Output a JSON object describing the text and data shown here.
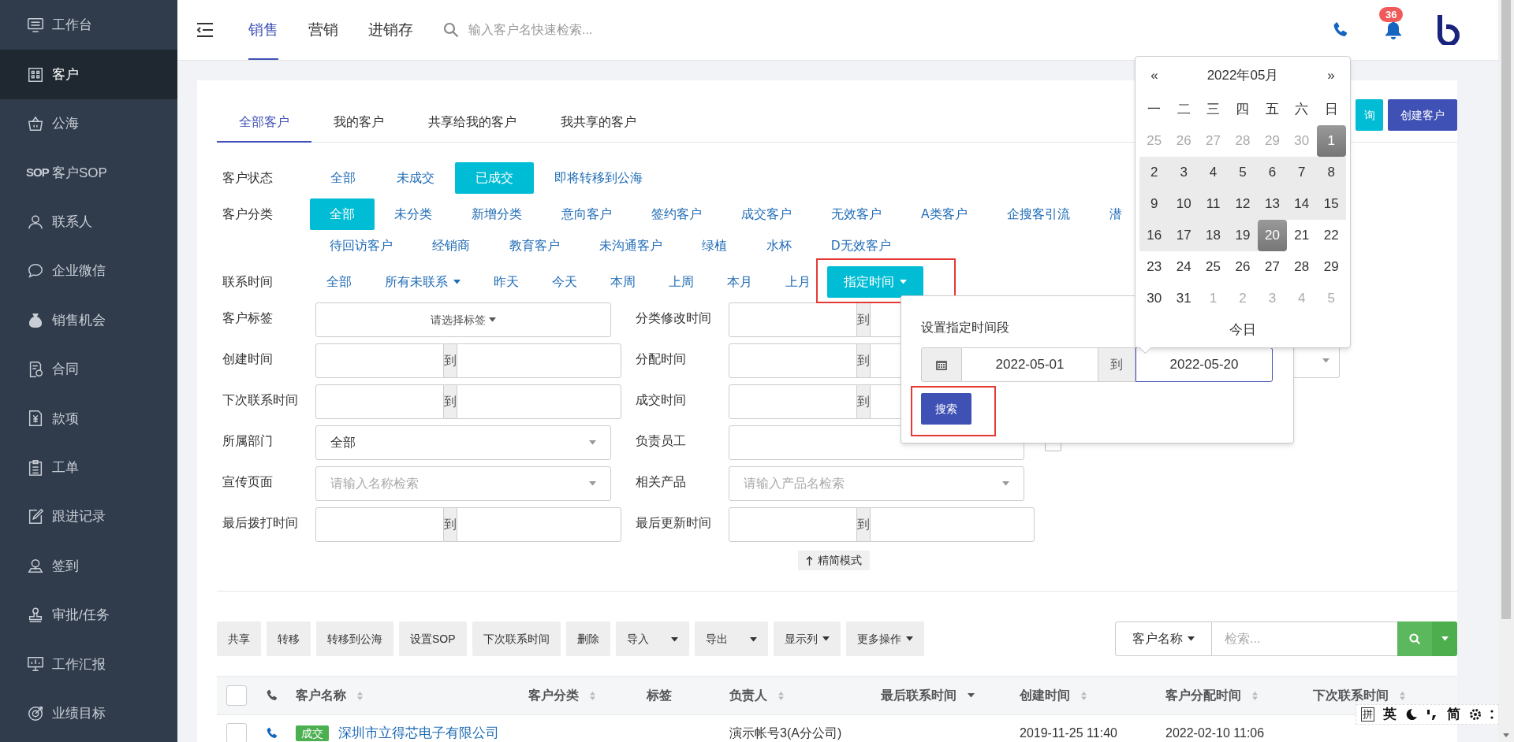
{
  "sidebar": {
    "items": [
      {
        "label": "工作台",
        "selected": false
      },
      {
        "label": "客户",
        "selected": true
      },
      {
        "label": "公海",
        "selected": false
      },
      {
        "label": "客户SOP",
        "icon_text": "SOP",
        "selected": false
      },
      {
        "label": "联系人",
        "selected": false
      },
      {
        "label": "企业微信",
        "selected": false
      },
      {
        "label": "销售机会",
        "selected": false
      },
      {
        "label": "合同",
        "selected": false
      },
      {
        "label": "款项",
        "selected": false
      },
      {
        "label": "工单",
        "selected": false
      },
      {
        "label": "跟进记录",
        "selected": false
      },
      {
        "label": "签到",
        "selected": false
      },
      {
        "label": "审批/任务",
        "selected": false
      },
      {
        "label": "工作汇报",
        "selected": false
      },
      {
        "label": "业绩目标",
        "selected": false
      }
    ]
  },
  "header": {
    "tabs": [
      {
        "label": "销售",
        "selected": true
      },
      {
        "label": "营销",
        "selected": false
      },
      {
        "label": "进销存",
        "selected": false
      }
    ],
    "search": {
      "placeholder": "输入客户名快速检索..."
    },
    "notifications": {
      "count": "36"
    }
  },
  "customer_tabs": [
    {
      "label": "全部客户",
      "selected": true
    },
    {
      "label": "我的客户",
      "selected": false
    },
    {
      "label": "共享给我的客户",
      "selected": false
    },
    {
      "label": "我共享的客户",
      "selected": false
    }
  ],
  "actions": [
    {
      "label": "询",
      "kind": "query"
    },
    {
      "label": "创建客户",
      "kind": "create"
    }
  ],
  "filters": [
    {
      "label": "客户状态",
      "lines": [
        [
          {
            "label": "全部",
            "selected": false
          },
          {
            "label": "未成交",
            "selected": false
          },
          {
            "label": "已成交",
            "selected": true
          },
          {
            "label": "即将转移到公海",
            "selected": false
          }
        ]
      ]
    },
    {
      "label": "客户分类",
      "lines": [
        [
          {
            "label": "全部",
            "selected": true
          },
          {
            "label": "未分类",
            "selected": false
          },
          {
            "label": "新增分类",
            "selected": false
          },
          {
            "label": "意向客户",
            "selected": false
          },
          {
            "label": "签约客户",
            "selected": false
          },
          {
            "label": "成交客户",
            "selected": false
          },
          {
            "label": "无效客户",
            "selected": false
          },
          {
            "label": "A类客户",
            "selected": false
          },
          {
            "label": "企搜客引流",
            "selected": false
          },
          {
            "label": "潜",
            "selected": false
          }
        ],
        [
          {
            "label": "待回访客户",
            "selected": false
          },
          {
            "label": "经销商",
            "selected": false
          },
          {
            "label": "教育客户",
            "selected": false
          },
          {
            "label": "未沟通客户",
            "selected": false
          },
          {
            "label": "绿植",
            "selected": false
          },
          {
            "label": "水杯",
            "selected": false
          },
          {
            "label": "D无效客户",
            "selected": false
          }
        ]
      ]
    },
    {
      "label": "联系时间",
      "lines": [
        [
          {
            "label": "全部",
            "selected": false,
            "dropdown": false,
            "highlighted": false
          },
          {
            "label": "所有未联系",
            "selected": false,
            "dropdown": true,
            "highlighted": false
          },
          {
            "label": "昨天",
            "selected": false,
            "dropdown": false,
            "highlighted": false
          },
          {
            "label": "今天",
            "selected": false,
            "dropdown": false,
            "highlighted": false
          },
          {
            "label": "本周",
            "selected": false,
            "dropdown": false,
            "highlighted": false
          },
          {
            "label": "上周",
            "selected": false,
            "dropdown": false,
            "highlighted": false
          },
          {
            "label": "本月",
            "selected": false,
            "dropdown": false,
            "highlighted": false
          },
          {
            "label": "上月",
            "selected": false,
            "dropdown": false,
            "highlighted": false
          },
          {
            "label": "指定时间",
            "selected": true,
            "dropdown": true,
            "highlighted": true
          }
        ]
      ]
    }
  ],
  "form": {
    "columns": [
      [
        {
          "label": "客户标签",
          "kind": "tag_select",
          "placeholder": "请选择标签"
        },
        {
          "label": "创建时间",
          "kind": "range",
          "separator": "到"
        },
        {
          "label": "下次联系时间",
          "kind": "range",
          "separator": "到"
        },
        {
          "label": "所属部门",
          "kind": "select",
          "value": "全部"
        },
        {
          "label": "宣传页面",
          "kind": "select",
          "placeholder": "请输入名称检索"
        },
        {
          "label": "最后拨打时间",
          "kind": "range",
          "separator": "到"
        }
      ],
      [
        {
          "label": "分类修改时间",
          "kind": "range",
          "separator": "到"
        },
        {
          "label": "分配时间",
          "kind": "range",
          "separator": "到"
        },
        {
          "label": "成交时间",
          "kind": "range",
          "separator": "到"
        },
        {
          "label": "负责员工",
          "kind": "text"
        },
        {
          "label": "相关产品",
          "kind": "select",
          "placeholder": "请输入产品名检索"
        },
        {
          "label": "最后更新时间",
          "kind": "range",
          "separator": "到"
        }
      ],
      [
        {
          "kind": "select"
        },
        {
          "kind": "checkbox",
          "checked": false
        }
      ]
    ],
    "compact_toggle": "精简模式"
  },
  "toolbar": {
    "buttons": [
      {
        "label": "共享",
        "kind": "plain"
      },
      {
        "label": "转移",
        "kind": "plain"
      },
      {
        "label": "转移到公海",
        "kind": "plain"
      },
      {
        "label": "设置SOP",
        "kind": "plain"
      },
      {
        "label": "下次联系时间",
        "kind": "plain"
      },
      {
        "label": "删除",
        "kind": "plain"
      },
      {
        "label": "导入",
        "kind": "split"
      },
      {
        "label": "导出",
        "kind": "split"
      },
      {
        "label": "显示列",
        "kind": "dropdown"
      },
      {
        "label": "更多操作",
        "kind": "dropdown"
      }
    ],
    "search": {
      "field": "客户名称",
      "placeholder": "检索..."
    }
  },
  "table": {
    "columns": [
      {
        "kind": "checkbox",
        "checked": false
      },
      {
        "kind": "phone"
      },
      {
        "kind": "text",
        "label": "客户名称",
        "sortable": true,
        "sorted": false
      },
      {
        "kind": "text",
        "label": "客户分类",
        "sortable": true,
        "sorted": false
      },
      {
        "kind": "text",
        "label": "标签",
        "sortable": false
      },
      {
        "kind": "text",
        "label": "负责人",
        "sortable": true,
        "sorted": false
      },
      {
        "kind": "text",
        "label": "最后联系时间",
        "sortable": true,
        "sorted": true
      },
      {
        "kind": "text",
        "label": "创建时间",
        "sortable": true,
        "sorted": false
      },
      {
        "kind": "text",
        "label": "客户分配时间",
        "sortable": true,
        "sorted": false
      },
      {
        "kind": "text",
        "label": "下次联系时间",
        "sortable": true,
        "sorted": false
      }
    ],
    "rows": [
      {
        "checked": false,
        "status": "成交",
        "name": "深圳市立得芯电子有限公司",
        "owner": "演示帐号3(A分公司)",
        "created": "2019-11-25 11:40",
        "assigned": "2022-02-10 11:06"
      }
    ]
  },
  "date_popover": {
    "title": "设置指定时间段",
    "start": "2022-05-01",
    "separator": "到",
    "end": "2022-05-20",
    "button": "搜索",
    "button_highlighted": true
  },
  "calendar": {
    "prev": "«",
    "month": "2022年05月",
    "next": "»",
    "weekdays": [
      "一",
      "二",
      "三",
      "四",
      "五",
      "六",
      "日"
    ],
    "weeks": [
      [
        {
          "d": "25",
          "muted": true,
          "in_range": false,
          "selected": false
        },
        {
          "d": "26",
          "muted": true,
          "in_range": false,
          "selected": false
        },
        {
          "d": "27",
          "muted": true,
          "in_range": false,
          "selected": false
        },
        {
          "d": "28",
          "muted": true,
          "in_range": false,
          "selected": false
        },
        {
          "d": "29",
          "muted": true,
          "in_range": false,
          "selected": false
        },
        {
          "d": "30",
          "muted": true,
          "in_range": false,
          "selected": false
        },
        {
          "d": "1",
          "muted": false,
          "in_range": false,
          "selected": true
        }
      ],
      [
        {
          "d": "2",
          "muted": false,
          "in_range": true,
          "selected": false
        },
        {
          "d": "3",
          "muted": false,
          "in_range": true,
          "selected": false
        },
        {
          "d": "4",
          "muted": false,
          "in_range": true,
          "selected": false
        },
        {
          "d": "5",
          "muted": false,
          "in_range": true,
          "selected": false
        },
        {
          "d": "6",
          "muted": false,
          "in_range": true,
          "selected": false
        },
        {
          "d": "7",
          "muted": false,
          "in_range": true,
          "selected": false
        },
        {
          "d": "8",
          "muted": false,
          "in_range": true,
          "selected": false
        }
      ],
      [
        {
          "d": "9",
          "muted": false,
          "in_range": true,
          "selected": false
        },
        {
          "d": "10",
          "muted": false,
          "in_range": true,
          "selected": false
        },
        {
          "d": "11",
          "muted": false,
          "in_range": true,
          "selected": false
        },
        {
          "d": "12",
          "muted": false,
          "in_range": true,
          "selected": false
        },
        {
          "d": "13",
          "muted": false,
          "in_range": true,
          "selected": false
        },
        {
          "d": "14",
          "muted": false,
          "in_range": true,
          "selected": false
        },
        {
          "d": "15",
          "muted": false,
          "in_range": true,
          "selected": false
        }
      ],
      [
        {
          "d": "16",
          "muted": false,
          "in_range": true,
          "selected": false
        },
        {
          "d": "17",
          "muted": false,
          "in_range": true,
          "selected": false
        },
        {
          "d": "18",
          "muted": false,
          "in_range": true,
          "selected": false
        },
        {
          "d": "19",
          "muted": false,
          "in_range": true,
          "selected": false
        },
        {
          "d": "20",
          "muted": false,
          "in_range": false,
          "selected": true
        },
        {
          "d": "21",
          "muted": false,
          "in_range": false,
          "selected": false
        },
        {
          "d": "22",
          "muted": false,
          "in_range": false,
          "selected": false
        }
      ],
      [
        {
          "d": "23",
          "muted": false,
          "in_range": false,
          "selected": false
        },
        {
          "d": "24",
          "muted": false,
          "in_range": false,
          "selected": false
        },
        {
          "d": "25",
          "muted": false,
          "in_range": false,
          "selected": false
        },
        {
          "d": "26",
          "muted": false,
          "in_range": false,
          "selected": false
        },
        {
          "d": "27",
          "muted": false,
          "in_range": false,
          "selected": false
        },
        {
          "d": "28",
          "muted": false,
          "in_range": false,
          "selected": false
        },
        {
          "d": "29",
          "muted": false,
          "in_range": false,
          "selected": false
        }
      ],
      [
        {
          "d": "30",
          "muted": false,
          "in_range": false,
          "selected": false
        },
        {
          "d": "31",
          "muted": false,
          "in_range": false,
          "selected": false
        },
        {
          "d": "1",
          "muted": true,
          "in_range": false,
          "selected": false
        },
        {
          "d": "2",
          "muted": true,
          "in_range": false,
          "selected": false
        },
        {
          "d": "3",
          "muted": true,
          "in_range": false,
          "selected": false
        },
        {
          "d": "4",
          "muted": true,
          "in_range": false,
          "selected": false
        },
        {
          "d": "5",
          "muted": true,
          "in_range": false,
          "selected": false
        }
      ]
    ],
    "today": "今日"
  },
  "input_method_bar": {
    "mode": "拼",
    "language": "英",
    "script": "简"
  }
}
